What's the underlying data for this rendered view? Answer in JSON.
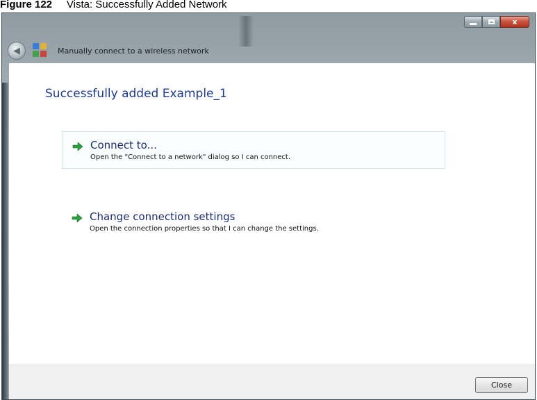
{
  "caption": {
    "figure_number": "Figure 122",
    "title": "Vista: Successfully Added Network"
  },
  "window": {
    "title": "Manually connect to a wireless network",
    "title_buttons": {
      "close_glyph": "x"
    }
  },
  "content": {
    "heading": "Successfully added Example_1",
    "options": [
      {
        "title": "Connect to...",
        "description": "Open the \"Connect to a network\" dialog so I can connect."
      },
      {
        "title": "Change connection settings",
        "description": "Open the connection properties so that I can change the settings."
      }
    ]
  },
  "footer": {
    "close_label": "Close"
  },
  "colors": {
    "heading": "#1f3b8a",
    "arrow": "#2e9e3e",
    "close_button_red": "#c9543f"
  },
  "icons": [
    "back-icon",
    "network-icon",
    "green-arrow-icon",
    "minimize-icon",
    "maximize-icon",
    "close-icon"
  ]
}
